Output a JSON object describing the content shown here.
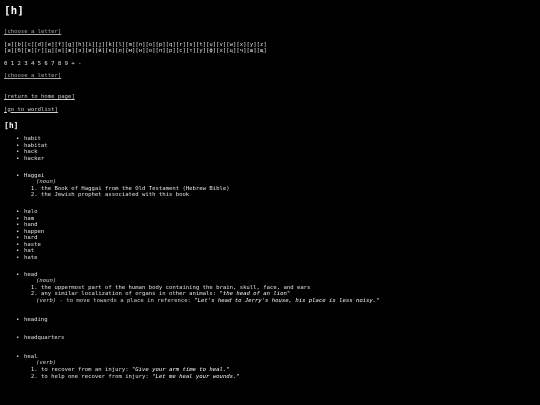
{
  "header": {
    "title": "[h]"
  },
  "letters_label_top": "[choose a letter]",
  "letter_rows": [
    "[a][b][c][d][e][f][g][h][i][j][k][l][m][n][o][p][q][r][s][t][u][v][w][x][y][z]",
    "[а][б][в][г][д][е][ж][з][и][й][к][л][м][н][о][п][р][с][т][у][ф][х][ц][ч][ш][щ]"
  ],
  "numbers_row": "0 1 2 3 4 5 6 7 8 9 + -",
  "letters_label_bottom": "[choose a letter]",
  "nav": {
    "home": "[return to home page]",
    "wordlist": "[go to wordlist]"
  },
  "section_title": "[h]",
  "entries": {
    "group1": [
      "habit",
      "habitat",
      "hack",
      "hacker"
    ],
    "haggai": {
      "word": "Haggai",
      "pos": "(noun)",
      "defs": [
        "the Book of Haggai from the Old Testament (Hebrew Bible)",
        "the Jewish prophet associated with this book"
      ]
    },
    "group2": [
      "halo",
      "ham",
      "hand",
      "happen",
      "hard",
      "haste",
      "hat",
      "hate"
    ],
    "head": {
      "word": "head",
      "pos_noun": "(noun)",
      "noun_defs": [
        {
          "text": "the uppermost part of the human body containing the brain, skull, face, and ears",
          "example": ""
        },
        {
          "text": "any similar localization of organs in other animals: ",
          "example": "\"the head of an lion\""
        }
      ],
      "pos_verb": "(verb)",
      "verb_text": " - to move towards a place in reference: ",
      "verb_example": "\"Let's head to Jerry's house, his place is less noisy.\""
    },
    "heading": "heading",
    "headquarters": "headquarters",
    "heal": {
      "word": "heal",
      "pos": "(verb)",
      "defs": [
        {
          "text": "to recover from an injury: ",
          "example": "\"Give your arm time to heal.\""
        },
        {
          "text": "to help one recover from injury: ",
          "example": "\"Let me heal your wounds.\""
        }
      ]
    }
  }
}
